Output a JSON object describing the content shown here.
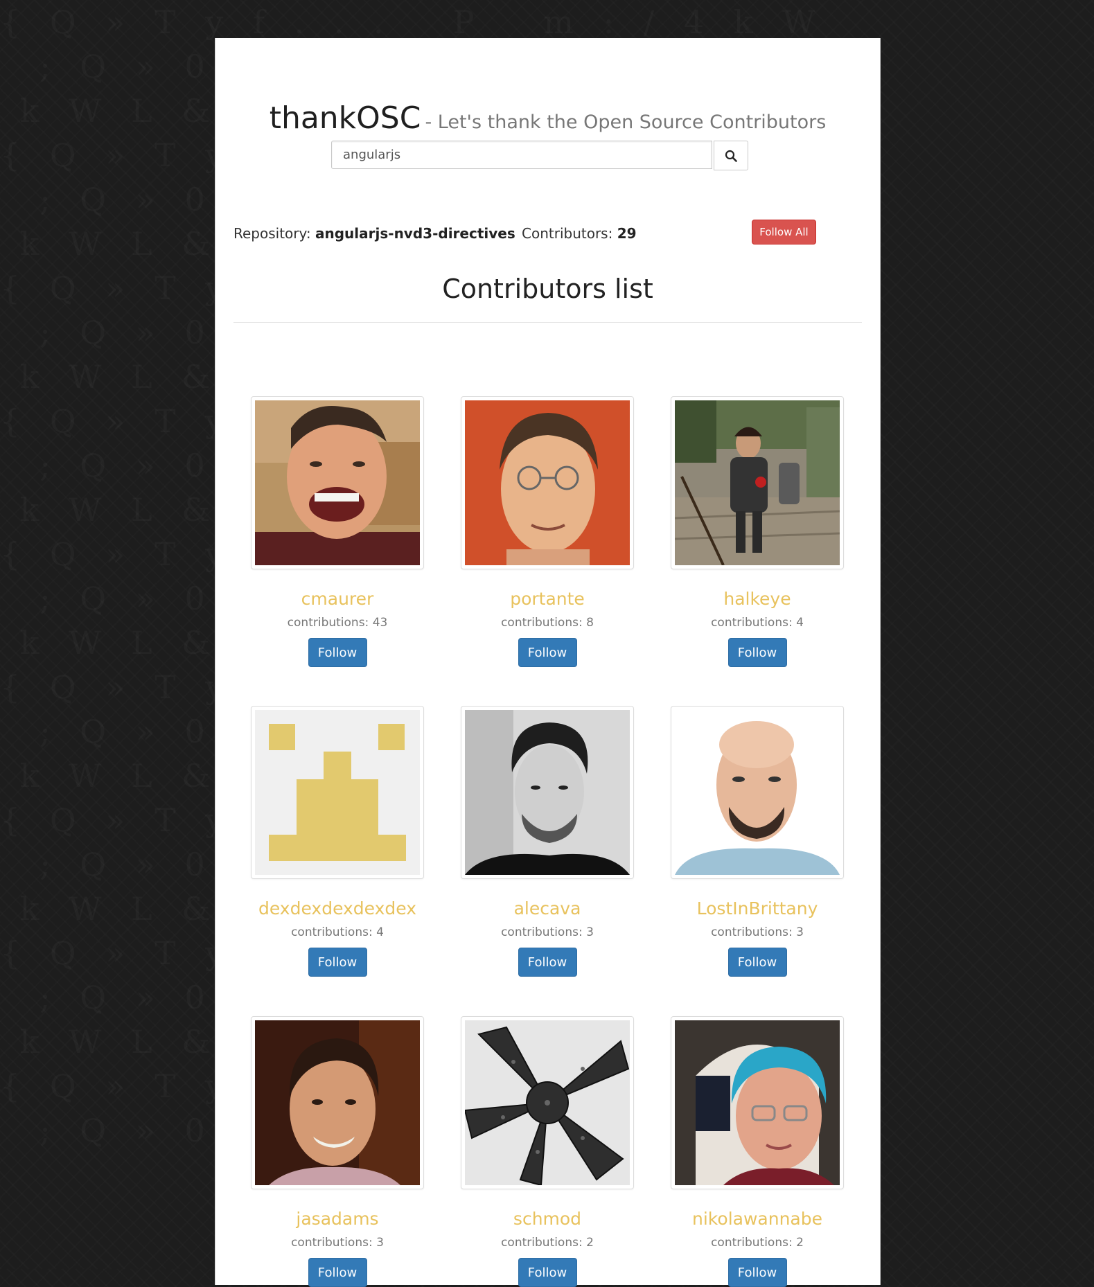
{
  "header": {
    "brand": "thankOSC",
    "tagline": "- Let's thank the Open Source Contributors"
  },
  "search": {
    "value": "angularjs",
    "button_icon": "search-icon"
  },
  "repository": {
    "label": "Repository:",
    "name": "angularjs-nvd3-directives",
    "contributors_label": "Contributors:",
    "contributors_count": "29",
    "follow_all_label": "Follow All"
  },
  "list": {
    "title": "Contributors list"
  },
  "colors": {
    "username": "#e8c25d",
    "follow_button": "#337ab7",
    "follow_all_button": "#d9534f",
    "background": "#1d1d1d"
  },
  "contributors": [
    {
      "username": "cmaurer",
      "contributions": "contributions: 43",
      "follow_label": "Follow",
      "avatar": "laughing-man-photo"
    },
    {
      "username": "portante",
      "contributions": "contributions: 8",
      "follow_label": "Follow",
      "avatar": "man-with-glasses-red-background-photo"
    },
    {
      "username": "halkeye",
      "contributions": "contributions: 4",
      "follow_label": "Follow",
      "avatar": "man-on-stairs-photo"
    },
    {
      "username": "dexdexdexdexdex",
      "contributions": "contributions: 4",
      "follow_label": "Follow",
      "avatar": "yellow-identicon"
    },
    {
      "username": "alecava",
      "contributions": "contributions: 3",
      "follow_label": "Follow",
      "avatar": "black-and-white-portrait-photo"
    },
    {
      "username": "LostInBrittany",
      "contributions": "contributions: 3",
      "follow_label": "Follow",
      "avatar": "bald-man-with-beard-photo"
    },
    {
      "username": "jasadams",
      "contributions": "contributions: 3",
      "follow_label": "Follow",
      "avatar": "smiling-man-photo"
    },
    {
      "username": "schmod",
      "contributions": "contributions: 2",
      "follow_label": "Follow",
      "avatar": "starfish-photo"
    },
    {
      "username": "nikolawannabe",
      "contributions": "contributions: 2",
      "follow_label": "Follow",
      "avatar": "blue-haired-woman-photo"
    }
  ]
}
